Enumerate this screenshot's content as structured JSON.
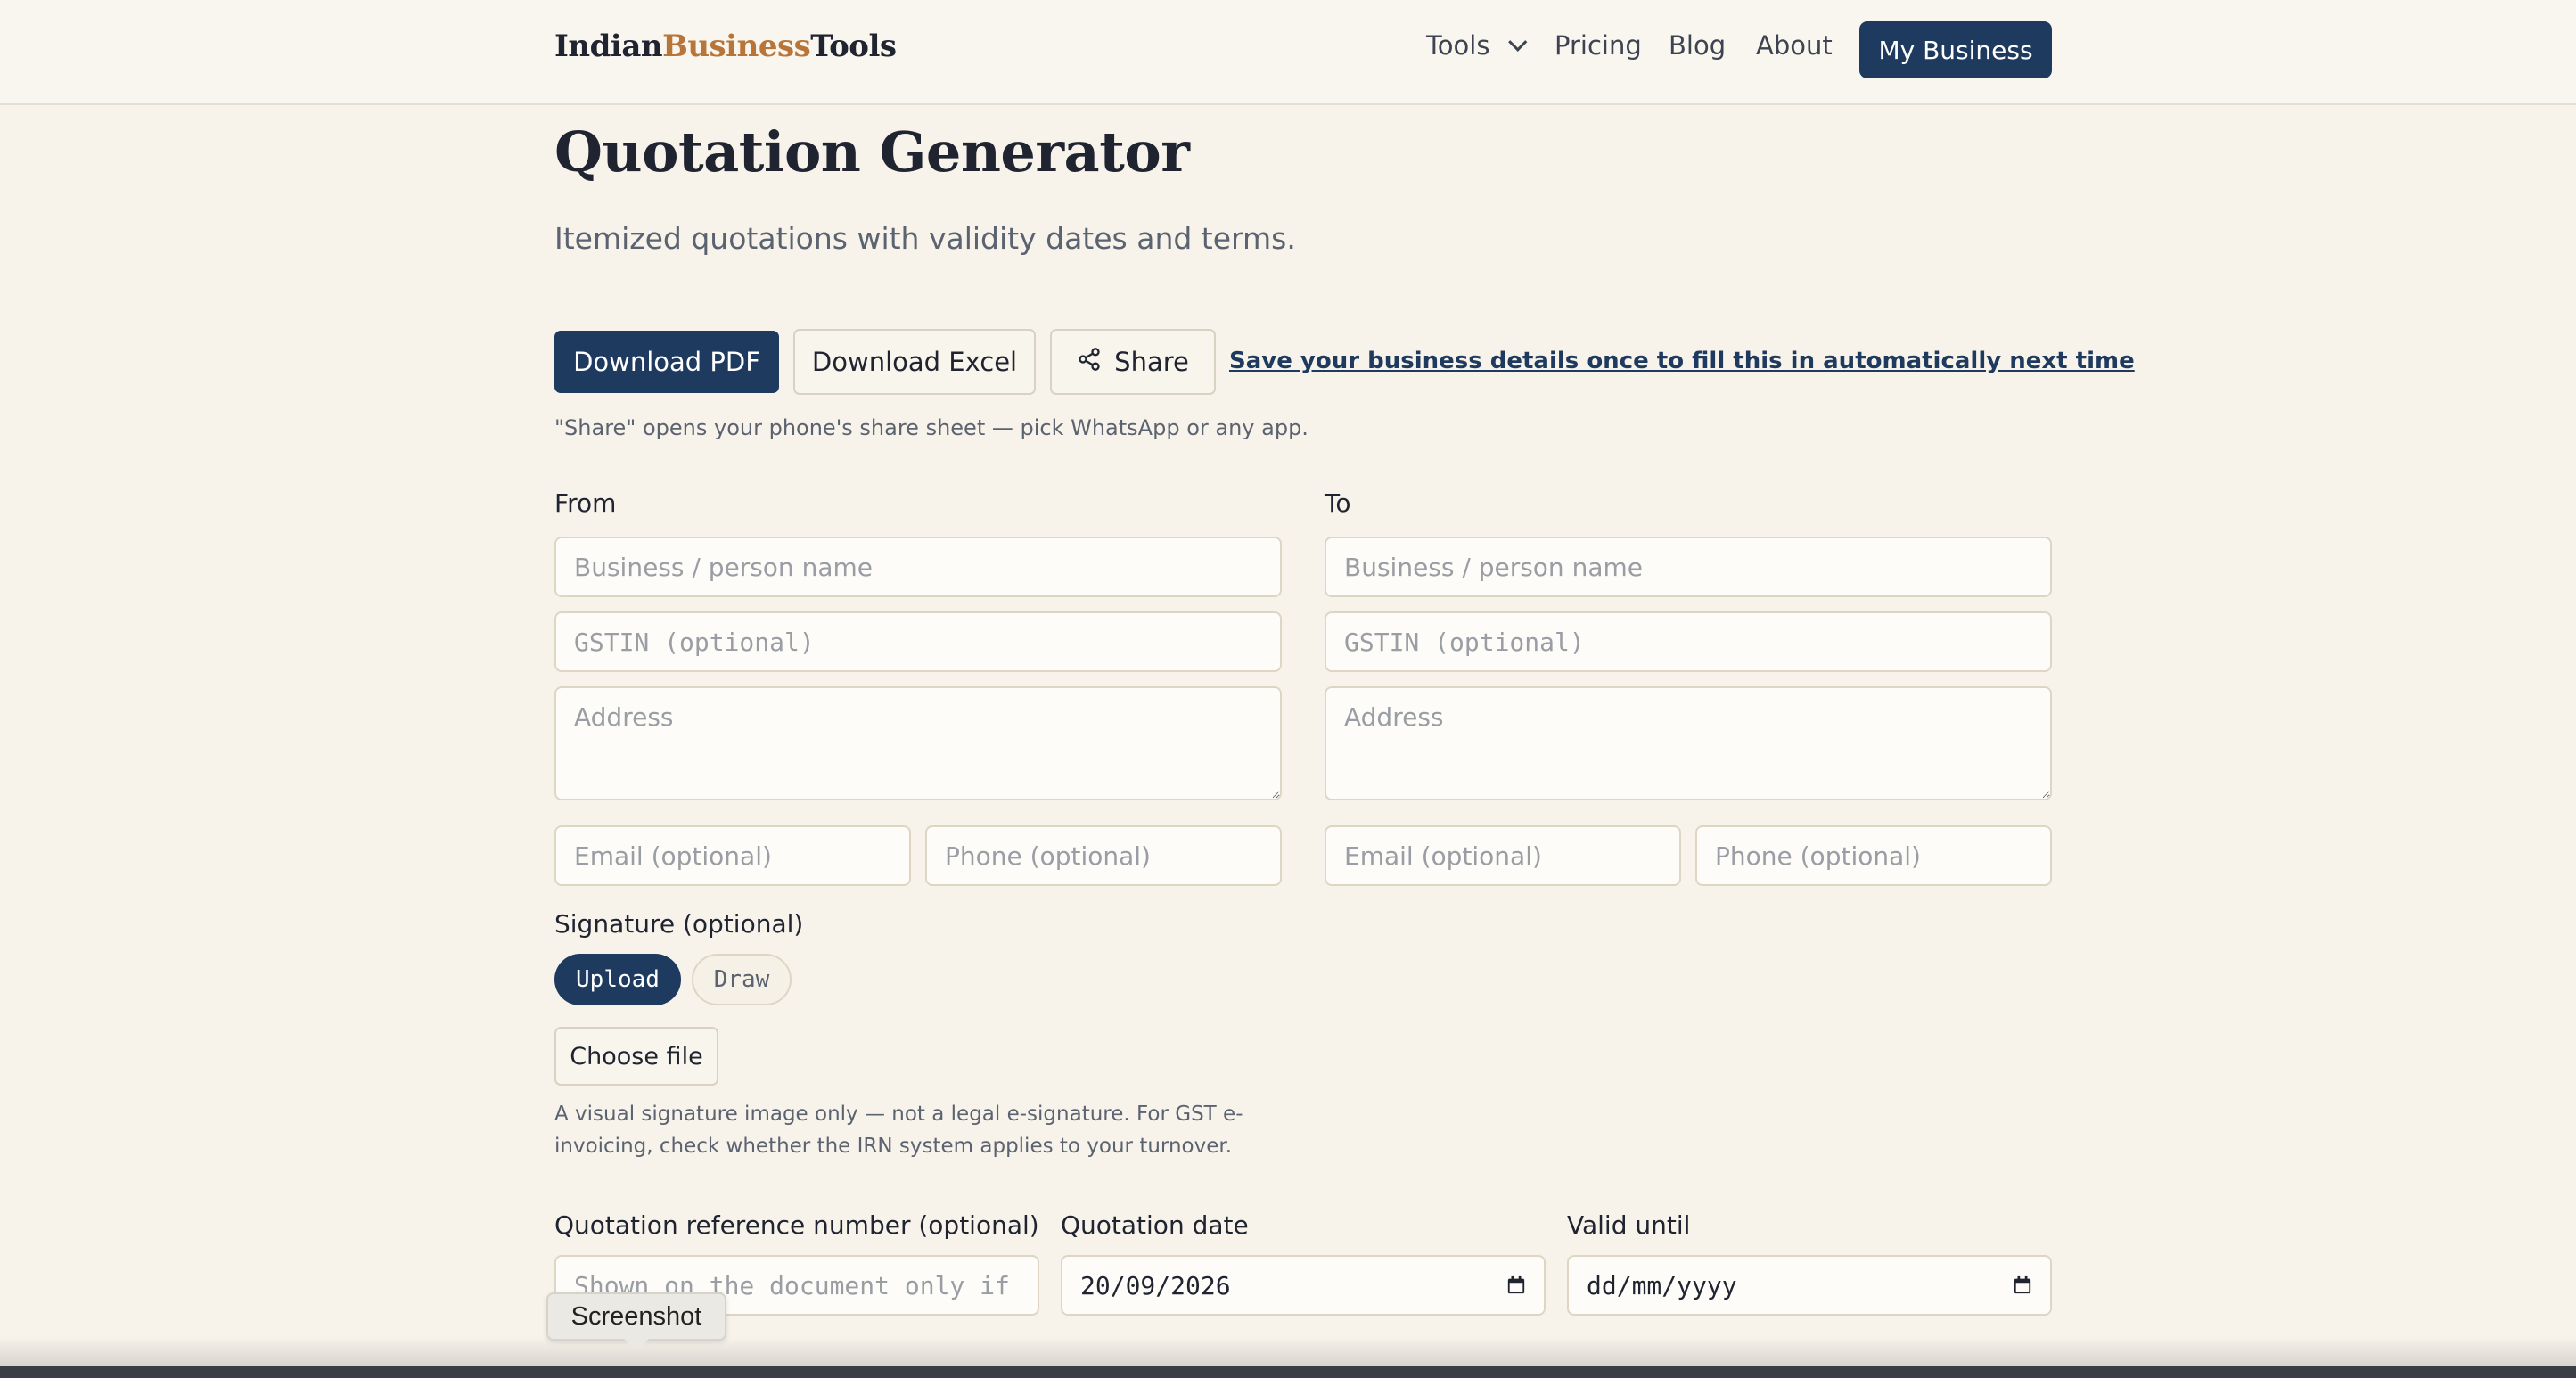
{
  "header": {
    "logo_part1": "Indian",
    "logo_part2": "Business",
    "logo_part3": "Tools",
    "nav": {
      "tools": "Tools",
      "pricing": "Pricing",
      "blog": "Blog",
      "about": "About"
    },
    "my_business": "My Business"
  },
  "page": {
    "title": "Quotation Generator",
    "subtitle": "Itemized quotations with validity dates and terms."
  },
  "actions": {
    "download_pdf": "Download PDF",
    "download_excel": "Download Excel",
    "share": "Share",
    "save_link": "Save your business details once to fill this in automatically next time",
    "share_hint": "\"Share\" opens your phone's share sheet — pick WhatsApp or any app."
  },
  "from": {
    "label": "From",
    "name_placeholder": "Business / person name",
    "gstin_placeholder": "GSTIN (optional)",
    "address_placeholder": "Address",
    "email_placeholder": "Email (optional)",
    "phone_placeholder": "Phone (optional)"
  },
  "to": {
    "label": "To",
    "name_placeholder": "Business / person name",
    "gstin_placeholder": "GSTIN (optional)",
    "address_placeholder": "Address",
    "email_placeholder": "Email (optional)",
    "phone_placeholder": "Phone (optional)"
  },
  "signature": {
    "label": "Signature (optional)",
    "upload": "Upload",
    "draw": "Draw",
    "choose_file": "Choose file",
    "note": "A visual signature image only — not a legal e-signature. For GST e-invoicing, check whether the IRN system applies to your turnover."
  },
  "quotation": {
    "ref_label": "Quotation reference number (optional)",
    "ref_placeholder": "Shown on the document only if",
    "date_label": "Quotation date",
    "date_value": "20/09/2026",
    "valid_label": "Valid until",
    "valid_value": "dd/mm/yyyy"
  },
  "tooltip": {
    "screenshot": "Screenshot"
  },
  "colors": {
    "primary": "#1e3a5f",
    "accent": "#b8753a",
    "background": "#f7f3eb"
  }
}
